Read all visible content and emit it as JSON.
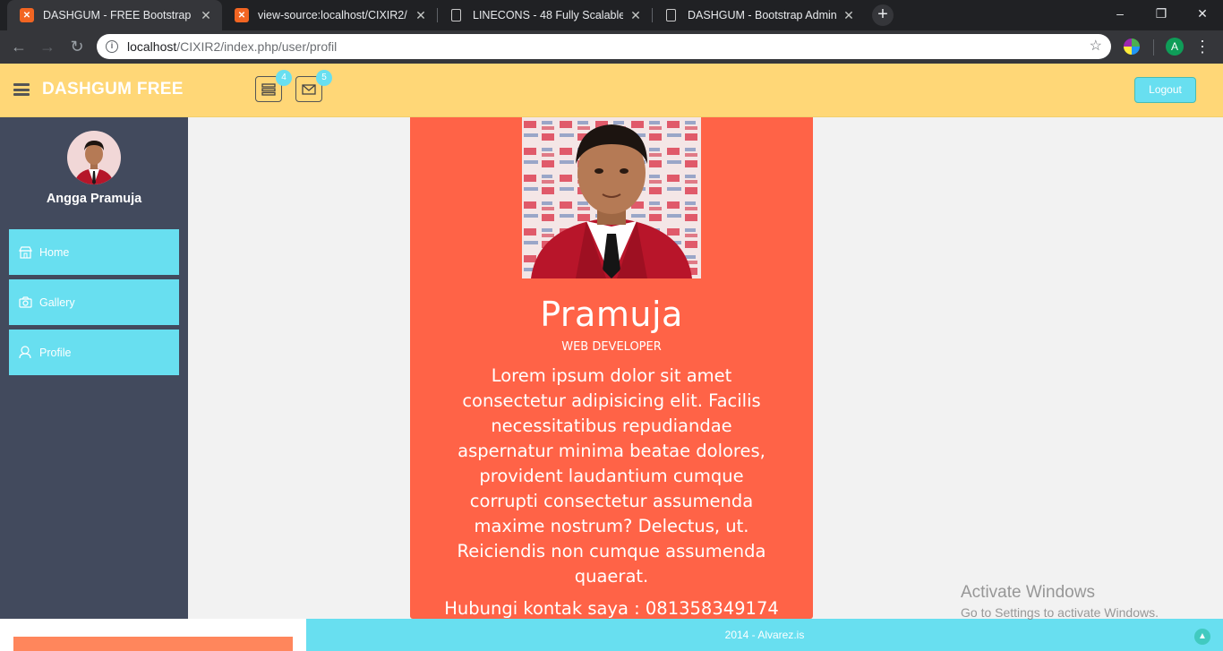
{
  "browser": {
    "tabs": [
      {
        "title": "DASHGUM - FREE Bootstrap Admin",
        "icon": "xampp-icon",
        "active": true
      },
      {
        "title": "view-source:localhost/CIXIR2/",
        "icon": "xampp-icon",
        "active": false
      },
      {
        "title": "LINECONS - 48 Fully Scalable Vec",
        "icon": "document-icon",
        "active": false
      },
      {
        "title": "DASHGUM - Bootstrap Admin Te",
        "icon": "document-icon",
        "active": false
      }
    ],
    "url_host": "localhost",
    "url_path": "/CIXIR2/index.php/user/profil",
    "profile_initial": "A"
  },
  "header": {
    "brand": "DASHGUM FREE",
    "tasks_badge": "4",
    "messages_badge": "5",
    "logout_label": "Logout",
    "bg_color": "#ffd777"
  },
  "sidebar": {
    "user_name": "Angga Pramuja",
    "items": [
      {
        "label": "Home",
        "icon": "home-icon"
      },
      {
        "label": "Gallery",
        "icon": "camera-icon"
      },
      {
        "label": "Profile",
        "icon": "user-icon"
      }
    ],
    "bg_color": "#424a5d",
    "item_color": "#68dff0"
  },
  "profile": {
    "name": "Pramuja",
    "role": "WEB DEVELOPER",
    "bio": "Lorem ipsum dolor sit amet consectetur adipisicing elit. Facilis necessitatibus repudiandae aspernatur minima beatae dolores, provident laudantium cumque corrupti consectetur assumenda maxime nostrum? Delectus, ut. Reiciendis non cumque assumenda quaerat.",
    "contact": "Hubungi kontak saya : 081358349174",
    "card_color": "#ff6347"
  },
  "footer": {
    "text": "2014 - Alvarez.is"
  },
  "watermark": {
    "line1": "Activate Windows",
    "line2": "Go to Settings to activate Windows."
  }
}
